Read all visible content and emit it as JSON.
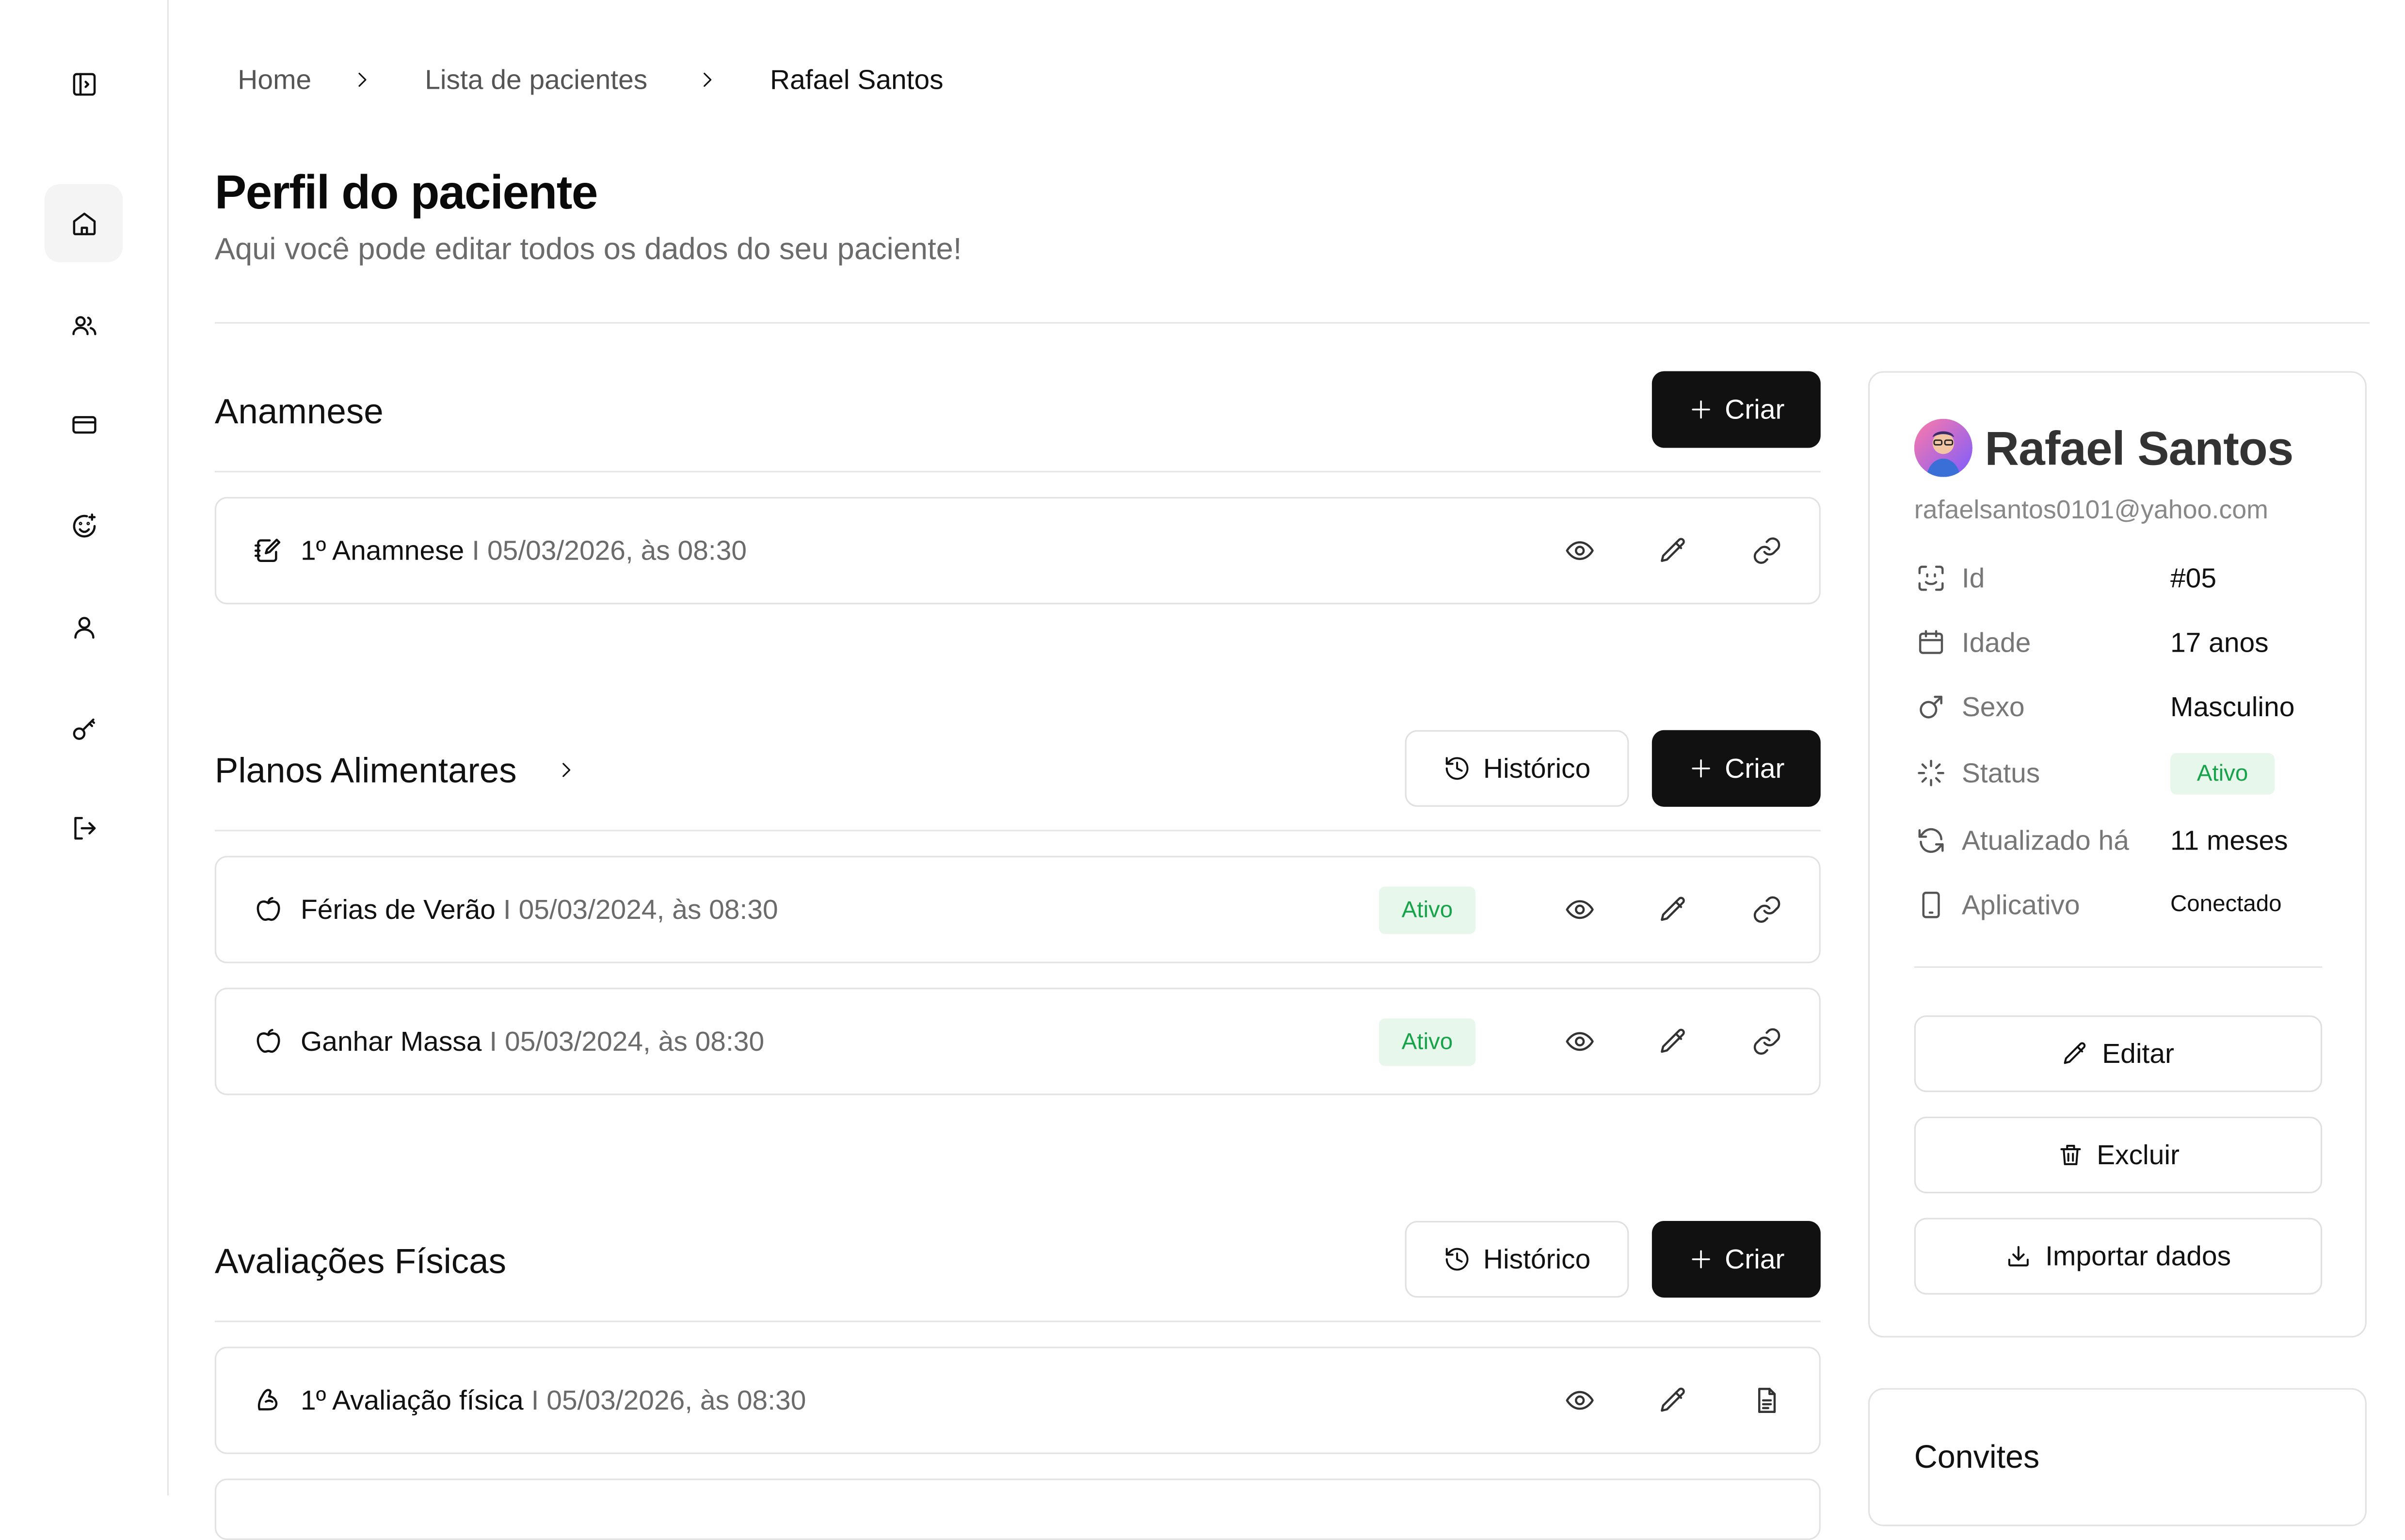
{
  "breadcrumb": {
    "home": "Home",
    "list": "Lista de pacientes",
    "current": "Rafael Santos"
  },
  "page": {
    "title": "Perfil do paciente",
    "subtitle": "Aqui você pode editar todos os dados do seu paciente!"
  },
  "sidebar": {
    "icons": [
      "sidebar-toggle-icon",
      "home-icon",
      "users-icon",
      "card-icon",
      "smile-plus-icon",
      "user-icon",
      "key-icon",
      "logout-icon"
    ],
    "active": "home-icon"
  },
  "anamnese": {
    "title": "Anamnese",
    "create_label": "Criar",
    "items": [
      {
        "name": "1º Anamnese",
        "sep": "I",
        "date": "05/03/2026, às 08:30"
      }
    ]
  },
  "planos": {
    "title": "Planos Alimentares",
    "history_label": "Histórico",
    "create_label": "Criar",
    "items": [
      {
        "name": "Férias de Verão",
        "sep": "I",
        "date": "05/03/2024, às 08:30",
        "status": "Ativo"
      },
      {
        "name": "Ganhar Massa",
        "sep": "I",
        "date": "05/03/2024, às 08:30",
        "status": "Ativo"
      }
    ]
  },
  "avaliacoes": {
    "title": "Avaliações Físicas",
    "history_label": "Histórico",
    "create_label": "Criar",
    "items": [
      {
        "name": "1º Avaliação física",
        "sep": "I",
        "date": "05/03/2026, às 08:30"
      }
    ]
  },
  "profile": {
    "name": "Rafael Santos",
    "email": "rafaelsantos0101@yahoo.com",
    "fields": [
      {
        "label": "Id",
        "value": "#05",
        "icon": "id-scan-icon"
      },
      {
        "label": "Idade",
        "value": "17 anos",
        "icon": "calendar-icon"
      },
      {
        "label": "Sexo",
        "value": "Masculino",
        "icon": "male-icon"
      },
      {
        "label": "Status",
        "value": "Ativo",
        "icon": "loader-icon"
      },
      {
        "label": "Atualizado há",
        "value": "11 meses",
        "icon": "refresh-icon"
      },
      {
        "label": "Aplicativo",
        "value": "Conectado",
        "icon": "phone-icon"
      }
    ],
    "edit_label": "Editar",
    "delete_label": "Excluir",
    "import_label": "Importar dados"
  },
  "invites": {
    "title": "Convites"
  },
  "colors": {
    "primary": "#111111",
    "badge_bg": "#e8f7ec",
    "badge_text": "#16a34a",
    "border": "#e2e2e2",
    "muted": "#6b6b6b"
  }
}
